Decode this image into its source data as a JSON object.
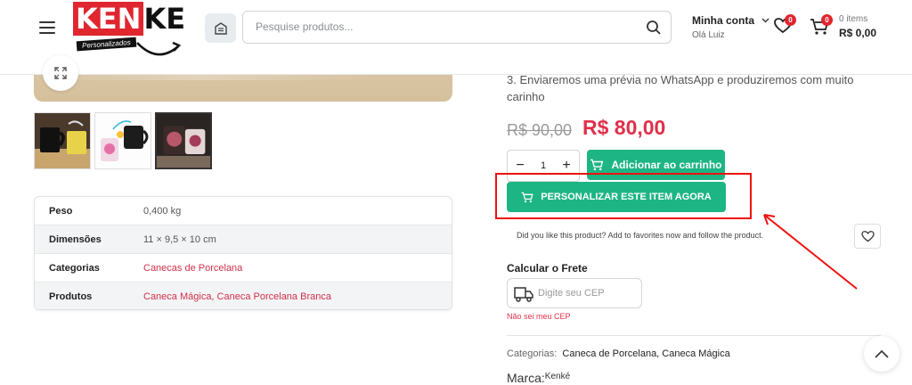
{
  "header": {
    "logo_text_red": "KEN",
    "logo_text_black": "KE",
    "logo_tagline": "Personalizados",
    "search_placeholder": "Pesquise produtos...",
    "account_title": "Minha conta",
    "account_greeting": "Olá Luiz",
    "wishlist_count": "0",
    "cart_count": "0",
    "cart_items_label": "0 items",
    "cart_total": "R$ 0,00"
  },
  "product": {
    "description_line": "3. Enviaremos uma prévia no WhatsApp e produziremos com muito carinho",
    "price_old": "R$ 90,00",
    "price_new": "R$ 80,00",
    "quantity": "1",
    "add_to_cart_label": "Adicionar ao carrinho",
    "personalize_label": "PERSONALIZAR ESTE ITEM AGORA",
    "favorite_text": "Did you like this product? Add to favorites now and follow the product.",
    "freight_title": "Calcular o Frete",
    "cep_placeholder": "Digite seu CEP",
    "no_cep_link": "Não sei meu CEP",
    "categories_label": "Categorias:",
    "categories_value": "Caneca de Porcelana, Caneca Mágica",
    "brand_label": "Marca:",
    "brand_value": "Kenké"
  },
  "specs": [
    {
      "key": "Peso",
      "value": "0,400 kg"
    },
    {
      "key": "Dimensões",
      "value": "11 × 9,5 × 10 cm"
    },
    {
      "key": "Categorias",
      "value": "Canecas de Porcelana"
    },
    {
      "key": "Produtos",
      "value": "Caneca Mágica, Caneca Porcelana Branca"
    }
  ],
  "colors": {
    "accent_green": "#1db584",
    "price_red": "#e0304a",
    "brand_red": "#e0262f",
    "annotation_red": "#ee1111"
  },
  "icons": [
    "menu-icon",
    "store-icon",
    "search-icon",
    "chevron-down-icon",
    "heart-icon",
    "cart-icon",
    "expand-icon",
    "truck-icon",
    "chevron-up-icon"
  ]
}
